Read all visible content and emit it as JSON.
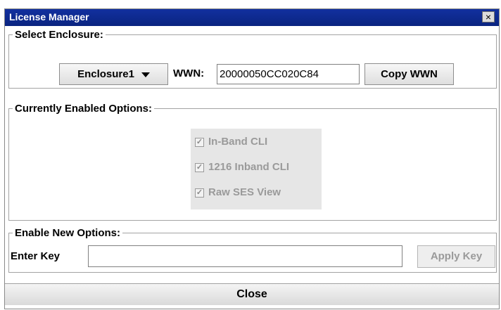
{
  "window": {
    "title": "License Manager",
    "close_glyph": "×"
  },
  "select_enclosure": {
    "legend": "Select Enclosure:",
    "enclosure_selected": "Enclosure1",
    "wwn_label": "WWN:",
    "wwn_value": "20000050CC020C84",
    "copy_button": "Copy WWN"
  },
  "enabled_options": {
    "legend": "Currently Enabled Options:",
    "items": [
      {
        "label": "In-Band CLI",
        "checked": true,
        "check_glyph": "✓"
      },
      {
        "label": "1216 Inband CLI",
        "checked": true,
        "check_glyph": "✓"
      },
      {
        "label": "Raw SES View",
        "checked": true,
        "check_glyph": "✓"
      }
    ]
  },
  "new_options": {
    "legend": "Enable New Options:",
    "key_label": "Enter Key",
    "key_value": "",
    "apply_button": "Apply Key"
  },
  "footer": {
    "close_button": "Close"
  },
  "colors": {
    "titlebar": "#0a2480",
    "disabled_text": "#9a9a9a",
    "options_bg": "#e6e6e6"
  },
  "icons": {
    "close": "close-icon",
    "dropdown": "chevron-down-icon",
    "checkbox": "checkbox-checked-icon"
  }
}
